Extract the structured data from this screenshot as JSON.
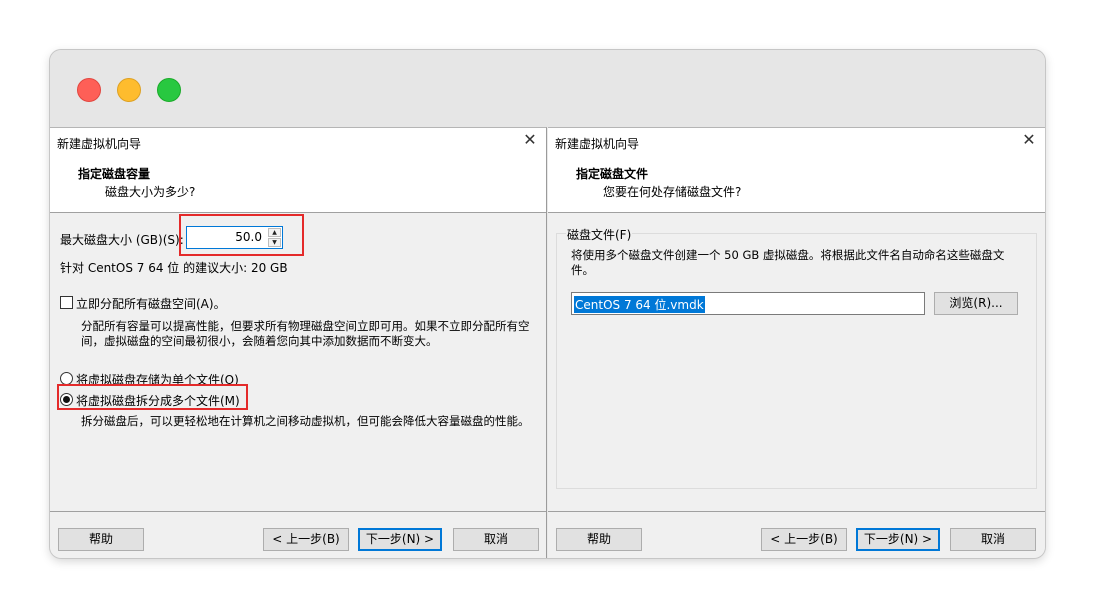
{
  "left": {
    "title": "新建虚拟机向导",
    "heading": "指定磁盘容量",
    "subheading": "磁盘大小为多少?",
    "max_size_label": "最大磁盘大小 (GB)(S):",
    "max_size_value": "50.0",
    "recommend_text": "针对 CentOS 7 64 位 的建议大小: 20 GB",
    "allocate_label": "立即分配所有磁盘空间(A)。",
    "allocate_checked": false,
    "allocate_desc": "分配所有容量可以提高性能，但要求所有物理磁盘空间立即可用。如果不立即分配所有空间，虚拟磁盘的空间最初很小，会随着您向其中添加数据而不断变大。",
    "single_file_label": "将虚拟磁盘存储为单个文件(O)",
    "multi_file_label": "将虚拟磁盘拆分成多个文件(M)",
    "selected_option": "multi",
    "multi_desc": "拆分磁盘后，可以更轻松地在计算机之间移动虚拟机，但可能会降低大容量磁盘的性能。",
    "buttons": {
      "help": "帮助",
      "back": "< 上一步(B)",
      "next": "下一步(N) >",
      "cancel": "取消"
    }
  },
  "right": {
    "title": "新建虚拟机向导",
    "heading": "指定磁盘文件",
    "subheading": "您要在何处存储磁盘文件?",
    "group_label": "磁盘文件(F)",
    "group_desc": "将使用多个磁盘文件创建一个 50 GB 虚拟磁盘。将根据此文件名自动命名这些磁盘文件。",
    "file_value": "CentOS 7 64 位.vmdk",
    "browse_label": "浏览(R)...",
    "buttons": {
      "help": "帮助",
      "back": "< 上一步(B)",
      "next": "下一步(N) >",
      "cancel": "取消"
    }
  },
  "colors": {
    "highlight": "#e42a2a",
    "accent": "#0078d7"
  }
}
